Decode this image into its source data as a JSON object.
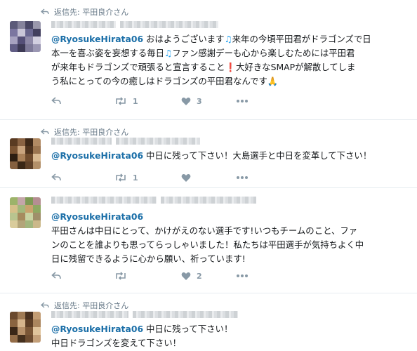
{
  "tweets": [
    {
      "context": "返信先: 平田良介さん",
      "mention": "@RyosukeHirata06",
      "lines": [
        [
          "おはようございます",
          "note",
          "来年の今頃平田君がドラゴンズで日"
        ],
        [
          "本一を喜ぶ姿を妄想する毎日",
          "note",
          "ファン感謝デーも心から楽しむためには平田君"
        ],
        [
          "が来年もドラゴンズで頑張ると宣言すること",
          "bang",
          "大好きなSMAPが解散してしま"
        ],
        [
          "う私にとっての今の癒しはドラゴンズの平田君なんです",
          "hands",
          ""
        ]
      ],
      "retweets": "1",
      "likes": "3"
    },
    {
      "context": "返信先: 平田良介さん",
      "mention": "@RyosukeHirata06",
      "text": "中日に残って下さい！大島選手と中日を変革して下さい！",
      "retweets": "1",
      "likes": ""
    },
    {
      "mention": "@RyosukeHirata06",
      "lines3": [
        "平田さんは中日にとって、かけがえのない選手です!いつもチームのこと、ファ",
        "ンのことを誰よりも思ってらっしゃいました！私たちは平田選手が気持ちよく中",
        "日に残留できるように心から願い、祈っています!"
      ],
      "retweets": "",
      "likes": "2"
    },
    {
      "context": "返信先: 平田良介さん",
      "mention": "@RyosukeHirata06",
      "text": "中日に残って下さい！",
      "line2": "中日ドラゴンズを変えて下さい！"
    }
  ],
  "emoji": {
    "note": "♫",
    "bang": "❗",
    "hands": "🙏"
  },
  "icons": [
    "reply-icon",
    "retweet-icon",
    "heart-icon",
    "more-icon",
    "reply-arrow-icon"
  ],
  "colors": {
    "link": "#1b6fa8",
    "muted": "#8899a6",
    "border": "#e6ecf0"
  }
}
